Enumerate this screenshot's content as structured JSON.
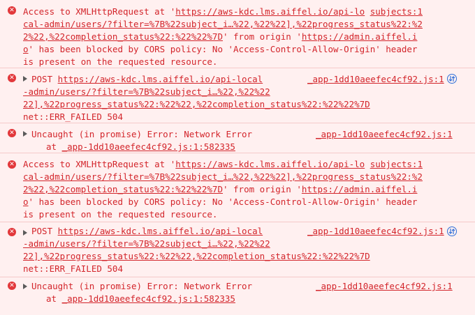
{
  "colors": {
    "error_text": "#d3252b",
    "error_background": "#fff0f0",
    "error_icon": "#e2383b",
    "network_icon": "#2e6fd9"
  },
  "icons": {
    "error": "error-circle-icon",
    "expand": "expand-triangle-icon",
    "network": "network-request-icon"
  },
  "entries": [
    {
      "type": "cors",
      "lines": [
        {
          "pre": "Access to XMLHttpRequest at '",
          "link": "https://aws-kdc.lms.aiffel.io/api-lo",
          "post": " ",
          "link2": "subjects:1"
        },
        {
          "pre": "",
          "link": "cal-admin/users/?filter=%7B%22subject_i…%22,%22%22],%22progress_status%22:%2",
          "post": "",
          "link2": ""
        },
        {
          "pre": "",
          "link": "2%22,%22completion_status%22:%22%22%7D",
          "post": "' from origin '",
          "link2": "https://admin.aiffel.i"
        },
        {
          "pre": "",
          "link": "o",
          "post": "' has been blocked by CORS policy: No 'Access-Control-Allow-Origin' header",
          "link2": ""
        },
        {
          "pre": "is present on the requested resource.",
          "link": "",
          "post": "",
          "link2": ""
        }
      ]
    },
    {
      "type": "post",
      "method": "POST",
      "url_1": "https://aws-kdc.lms.aiffel.io/api-local",
      "source": "_app-1dd10aeefec4cf92.js:1",
      "url_2": "-admin/users/?filter=%7B%22subject_i…%22,%22%22",
      "url_3": "22],%22progress_status%22:%22%22,%22completion_status%22:%22%22%7D",
      "status": "net::ERR_FAILED 504"
    },
    {
      "type": "uncaught",
      "message": "Uncaught (in promise) Error: Network Error",
      "source": "_app-1dd10aeefec4cf92.js:1",
      "stack_prefix": "at ",
      "stack_link": "_app-1dd10aeefec4cf92.js:1:582335"
    },
    {
      "type": "cors",
      "lines": [
        {
          "pre": "Access to XMLHttpRequest at '",
          "link": "https://aws-kdc.lms.aiffel.io/api-lo",
          "post": " ",
          "link2": "subjects:1"
        },
        {
          "pre": "",
          "link": "cal-admin/users/?filter=%7B%22subject_i…%22,%22%22],%22progress_status%22:%2",
          "post": "",
          "link2": ""
        },
        {
          "pre": "",
          "link": "2%22,%22completion_status%22:%22%22%7D",
          "post": "' from origin '",
          "link2": "https://admin.aiffel.i"
        },
        {
          "pre": "",
          "link": "o",
          "post": "' has been blocked by CORS policy: No 'Access-Control-Allow-Origin' header",
          "link2": ""
        },
        {
          "pre": "is present on the requested resource.",
          "link": "",
          "post": "",
          "link2": ""
        }
      ]
    },
    {
      "type": "post",
      "method": "POST",
      "url_1": "https://aws-kdc.lms.aiffel.io/api-local",
      "source": "_app-1dd10aeefec4cf92.js:1",
      "url_2": "-admin/users/?filter=%7B%22subject_i…%22,%22%22",
      "url_3": "22],%22progress_status%22:%22%22,%22completion_status%22:%22%22%7D",
      "status": "net::ERR_FAILED 504"
    },
    {
      "type": "uncaught",
      "message": "Uncaught (in promise) Error: Network Error",
      "source": "_app-1dd10aeefec4cf92.js:1",
      "stack_prefix": "at ",
      "stack_link": "_app-1dd10aeefec4cf92.js:1:582335"
    }
  ]
}
